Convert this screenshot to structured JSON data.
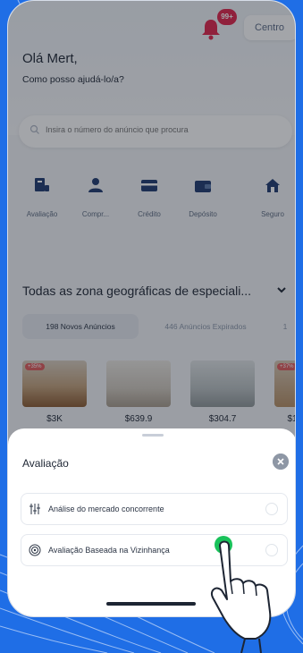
{
  "header": {
    "notification_badge": "99+",
    "location": "Centro"
  },
  "greeting": {
    "title": "Olá Mert,",
    "subtitle": "Como posso ajudá-lo/a?"
  },
  "search": {
    "placeholder": "Insira o número do anúncio que procura"
  },
  "categories": [
    {
      "label": "Avaliação",
      "icon": "valuation-icon"
    },
    {
      "label": "Compr...",
      "icon": "buyer-icon"
    },
    {
      "label": "Crédito",
      "icon": "credit-card-icon"
    },
    {
      "label": "Depósito",
      "icon": "wallet-icon"
    },
    {
      "label": "Seguro",
      "icon": "home-shield-icon"
    }
  ],
  "section": {
    "title": "Todas as zona geográficas de especiali..."
  },
  "tabs": [
    {
      "label": "198 Novos Anúncios",
      "active": true
    },
    {
      "label": "446 Anúncios Expirados",
      "active": false
    },
    {
      "label": "1",
      "active": false
    }
  ],
  "listings": [
    {
      "price": "$3K",
      "tag": "+35%"
    },
    {
      "price": "$639.9",
      "tag": ""
    },
    {
      "price": "$304.7",
      "tag": ""
    },
    {
      "price": "$1",
      "tag": "+37%"
    }
  ],
  "sheet": {
    "title": "Avaliação",
    "options": [
      {
        "label": "Análise do mercado concorrente",
        "icon": "sliders-icon"
      },
      {
        "label": "Avaliação Baseada na Vizinhança",
        "icon": "target-icon"
      }
    ]
  },
  "colors": {
    "background": "#1f6ee6",
    "accent": "#1f6ee6",
    "badge": "#e0244a",
    "tap_dot": "#19c25a"
  }
}
